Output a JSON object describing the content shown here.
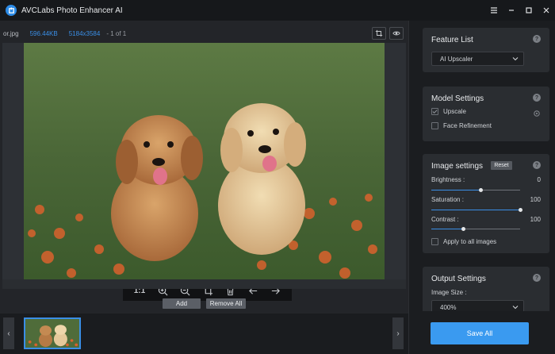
{
  "app": {
    "title": "AVCLabs Photo Enhancer AI"
  },
  "window_controls": {
    "menu": "☰",
    "minimize": "–",
    "maximize": "□",
    "close": "✕"
  },
  "info": {
    "file_name": "or.jpg",
    "file_size": "596.44KB",
    "dimensions": "5184x3584",
    "count": "- 1 of 1"
  },
  "viewer_toolbar": {
    "ratio_label": "1:1"
  },
  "actions": {
    "add_label": "Add",
    "remove_all_label": "Remove All"
  },
  "thumb_nav": {
    "prev": "‹",
    "next": "›"
  },
  "feature_list": {
    "title": "Feature List",
    "selected": "AI Upscaler"
  },
  "model_settings": {
    "title": "Model Settings",
    "upscale_label": "Upscale",
    "upscale_checked": true,
    "face_refinement_label": "Face Refinement",
    "face_refinement_checked": false
  },
  "image_settings": {
    "title": "Image settings",
    "reset_label": "Reset",
    "brightness_label": "Brightness :",
    "brightness_value": "0",
    "brightness_fraction": 0.55,
    "saturation_label": "Saturation :",
    "saturation_value": "100",
    "saturation_fraction": 1.0,
    "contrast_label": "Contrast :",
    "contrast_value": "100",
    "contrast_fraction": 0.36,
    "apply_all_label": "Apply to all images"
  },
  "output_settings": {
    "title": "Output Settings",
    "image_size_label": "Image Size :",
    "image_size_value": "400%"
  },
  "save": {
    "label": "Save All"
  },
  "help": "?",
  "colors": {
    "accent": "#3a8ee6",
    "save": "#3a9af0"
  }
}
